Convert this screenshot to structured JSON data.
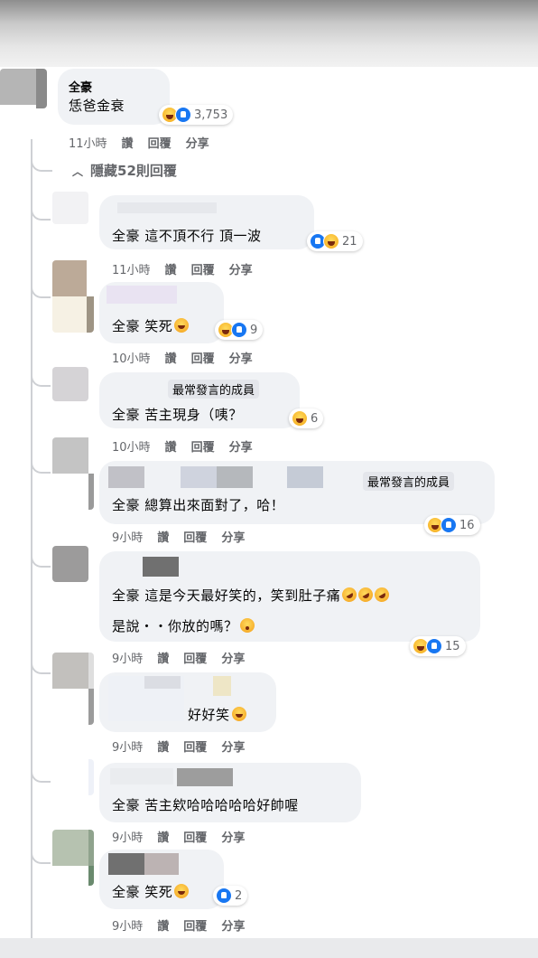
{
  "top_comment": {
    "name": "全豪",
    "text": "恁爸金衰",
    "reaction_count": "3,753",
    "meta": {
      "time": "11小時",
      "like": "讚",
      "reply": "回覆",
      "share": "分享"
    }
  },
  "hide_replies": "隱藏52則回覆",
  "replies": [
    {
      "name": "",
      "text": "全豪 這不頂不行 頂一波",
      "reaction_count": "21",
      "meta": {
        "time": "11小時",
        "like": "讚",
        "reply": "回覆",
        "share": "分享"
      }
    },
    {
      "name": "",
      "text": "全豪 笑死",
      "reaction_count": "9",
      "meta": {
        "time": "10小時",
        "like": "讚",
        "reply": "回覆",
        "share": "分享"
      }
    },
    {
      "badge": "最常發言的成員",
      "text": "全豪 苦主現身（咦？",
      "reaction_count": "6",
      "meta": {
        "time": "10小時",
        "like": "讚",
        "reply": "回覆",
        "share": "分享"
      }
    },
    {
      "badge": "最常發言的成員",
      "text": "全豪 總算出來面對了，哈！",
      "reaction_count": "16",
      "meta": {
        "time": "9小時",
        "like": "讚",
        "reply": "回覆",
        "share": "分享"
      }
    },
    {
      "text_line1": "全豪 這是今天最好笑的，笑到肚子痛",
      "text_line2": "是說・・你放的嗎？",
      "reaction_count": "15",
      "meta": {
        "time": "9小時",
        "like": "讚",
        "reply": "回覆",
        "share": "分享"
      }
    },
    {
      "text": "好好笑",
      "meta": {
        "time": "9小時",
        "like": "讚",
        "reply": "回覆",
        "share": "分享"
      }
    },
    {
      "text": "全豪 苦主欸哈哈哈哈哈好帥喔",
      "meta": {
        "time": "9小時",
        "like": "讚",
        "reply": "回覆",
        "share": "分享"
      }
    },
    {
      "text": "全豪 笑死",
      "reaction_count": "2",
      "meta": {
        "time": "9小時",
        "like": "讚",
        "reply": "回覆",
        "share": "分享"
      }
    }
  ],
  "colors": {
    "bubble": "#f0f2f5",
    "meta": "#65676b",
    "like_blue": "#1877f2",
    "haha_yellow": "#f7b125"
  }
}
